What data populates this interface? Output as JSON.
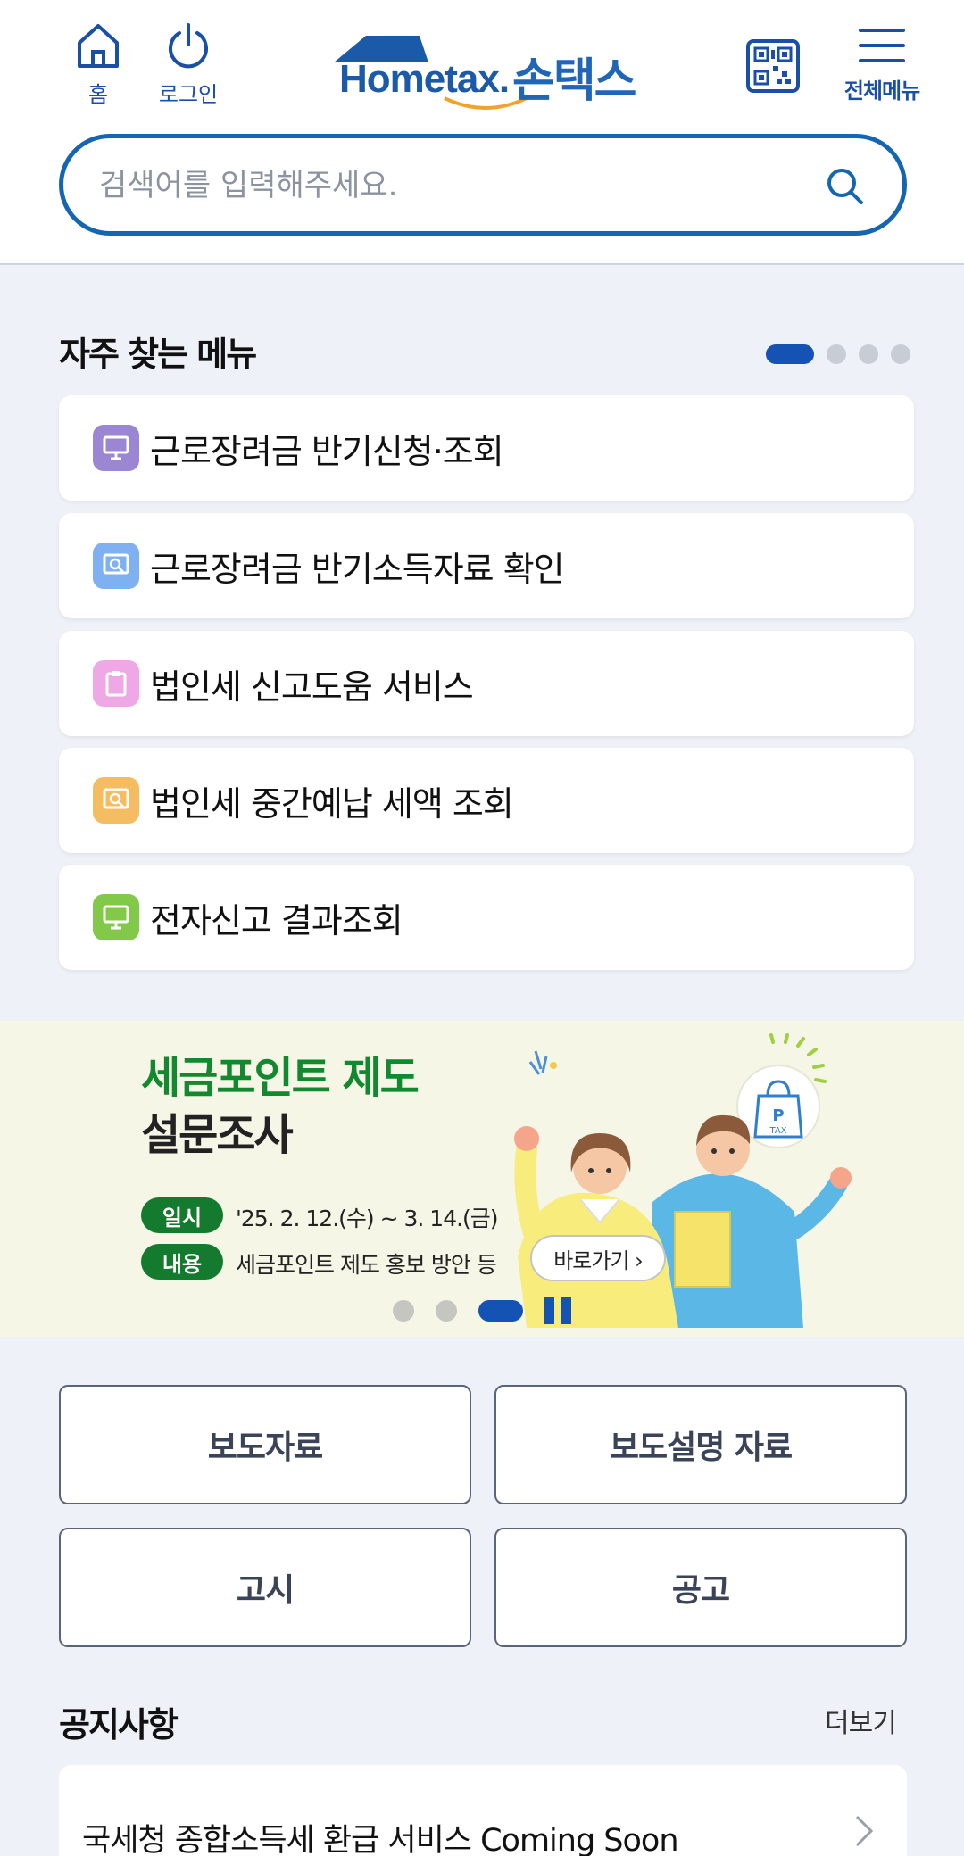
{
  "header": {
    "home_label": "홈",
    "login_label": "로그인",
    "logo_text": "Hometax.",
    "logo_kr": "손택스",
    "menu_label": "전체메뉴"
  },
  "search": {
    "placeholder": "검색어를 입력해주세요."
  },
  "favorites": {
    "title": "자주 찾는 메뉴",
    "page_count": 4,
    "active_page": 1,
    "items": [
      {
        "label": "근로장려금 반기신청·조회",
        "icon": "monitor-icon",
        "color": "#9a86d3"
      },
      {
        "label": "근로장려금 반기소득자료 확인",
        "icon": "search-document-icon",
        "color": "#7fb1f2"
      },
      {
        "label": "법인세 신고도움 서비스",
        "icon": "clipboard-icon",
        "color": "#eea8e6"
      },
      {
        "label": "법인세 중간예납 세액 조회",
        "icon": "search-document-icon",
        "color": "#f4bd62"
      },
      {
        "label": "전자신고 결과조회",
        "icon": "monitor-icon",
        "color": "#82c94a"
      }
    ]
  },
  "banner": {
    "title_line1": "세금포인트 제도",
    "title_line2": "설문조사",
    "date_tag": "일시",
    "date_text": "'25. 2. 12.(수) ~ 3. 14.(금)",
    "content_tag": "내용",
    "content_text": "세금포인트 제도 홍보 방안 등",
    "go_label": "바로가기 ›",
    "bag_label": "TAX",
    "bag_letter": "P",
    "slide_count": 3,
    "active_slide": 3
  },
  "quick_links": [
    {
      "label": "보도자료"
    },
    {
      "label": "보도설명 자료"
    },
    {
      "label": "고시"
    },
    {
      "label": "공고"
    }
  ],
  "notice": {
    "title": "공지사항",
    "more_label": "더보기",
    "items": [
      {
        "text": "국세청 종합소득세 환급 서비스 Coming Soon"
      }
    ]
  },
  "colors": {
    "brand_blue": "#1466b2",
    "accent_blue": "#1452b4",
    "banner_green": "#12892e",
    "page_bg": "#eef1f7"
  }
}
